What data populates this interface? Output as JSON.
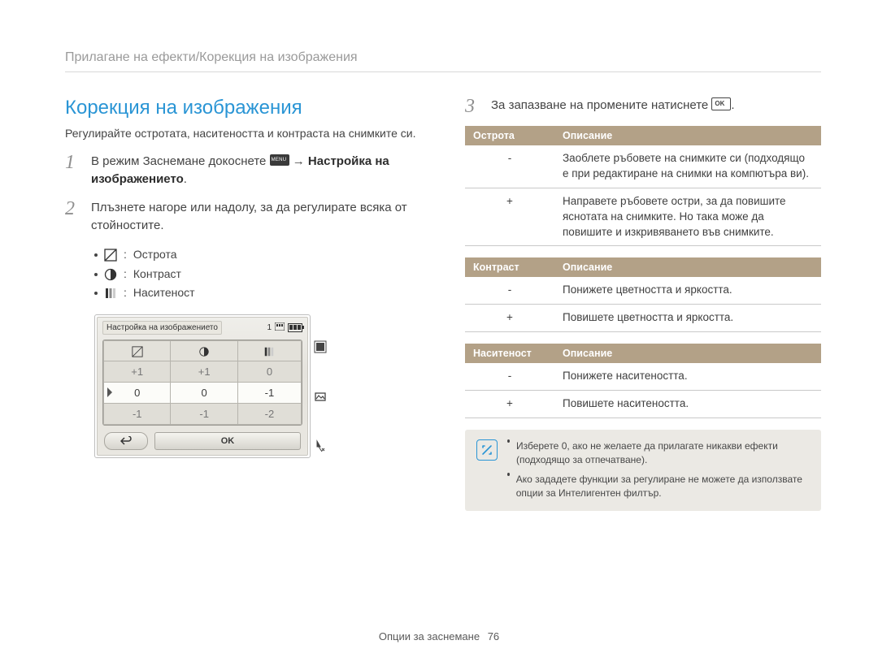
{
  "breadcrumb": "Прилагане на ефекти/Корекция на изображения",
  "heading": "Корекция на изображения",
  "intro": "Регулирайте остротата, наситеността и контраста на снимките си.",
  "step1": {
    "pre": "В режим Заснемане докоснете ",
    "arrow": " → ",
    "bold": "Настройка на изображението",
    "post": "."
  },
  "step2": "Плъзнете нагоре или надолу, за да регулирате всяка от стойностите.",
  "adjust_items": {
    "sharp": "Острота",
    "contrast": "Контраст",
    "sat": "Наситеност"
  },
  "camera": {
    "title": "Настройка на изображението",
    "count": "1",
    "row_dim": [
      "+1",
      "+1",
      "0"
    ],
    "row_sel": [
      "0",
      "0",
      "-1"
    ],
    "row_dim2": [
      "-1",
      "-1",
      "-2"
    ],
    "ok": "OK"
  },
  "step3": {
    "pre": "За запазване на промените натиснете ",
    "post": "."
  },
  "tables": {
    "sharp": {
      "h1": "Острота",
      "h2": "Описание",
      "rows": [
        {
          "k": "-",
          "v": "Заоблете ръбовете на снимките си (подходящо е при редактиране на снимки на компютъра ви)."
        },
        {
          "k": "+",
          "v": "Направете ръбовете остри, за да повишите яснотата на снимките. Но така може да повишите и изкривяването във снимките."
        }
      ]
    },
    "contrast": {
      "h1": "Контраст",
      "h2": "Описание",
      "rows": [
        {
          "k": "-",
          "v": "Понижете цветността и яркостта."
        },
        {
          "k": "+",
          "v": "Повишете цветността и яркостта."
        }
      ]
    },
    "sat": {
      "h1": "Наситеност",
      "h2": "Описание",
      "rows": [
        {
          "k": "-",
          "v": "Понижете наситеността."
        },
        {
          "k": "+",
          "v": "Повишете наситеността."
        }
      ]
    }
  },
  "notes": [
    "Изберете 0, ако не желаете да прилагате никакви ефекти (подходящо за отпечатване).",
    "Ако зададете функции за регулиране не можете да използвате опции за Интелигентен филтър."
  ],
  "footer": {
    "section": "Опции за заснемане",
    "page": "76"
  }
}
